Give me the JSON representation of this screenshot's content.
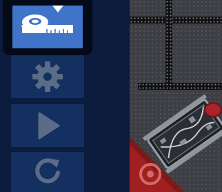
{
  "sidebar": {
    "items": [
      {
        "name": "measure",
        "icon": "tape-measure-icon",
        "selected": true
      },
      {
        "name": "settings",
        "icon": "gear-icon",
        "selected": false
      },
      {
        "name": "play",
        "icon": "play-icon",
        "selected": false
      },
      {
        "name": "reset",
        "icon": "reset-icon",
        "selected": false
      }
    ]
  },
  "colors": {
    "sidebar_bg": "#0b1c3f",
    "button_bg": "#143060",
    "selected_bg": "#3f74c8",
    "icon_muted": "#5b6c88",
    "field_bg": "#3d3f44",
    "field_corner": "#a02020"
  }
}
